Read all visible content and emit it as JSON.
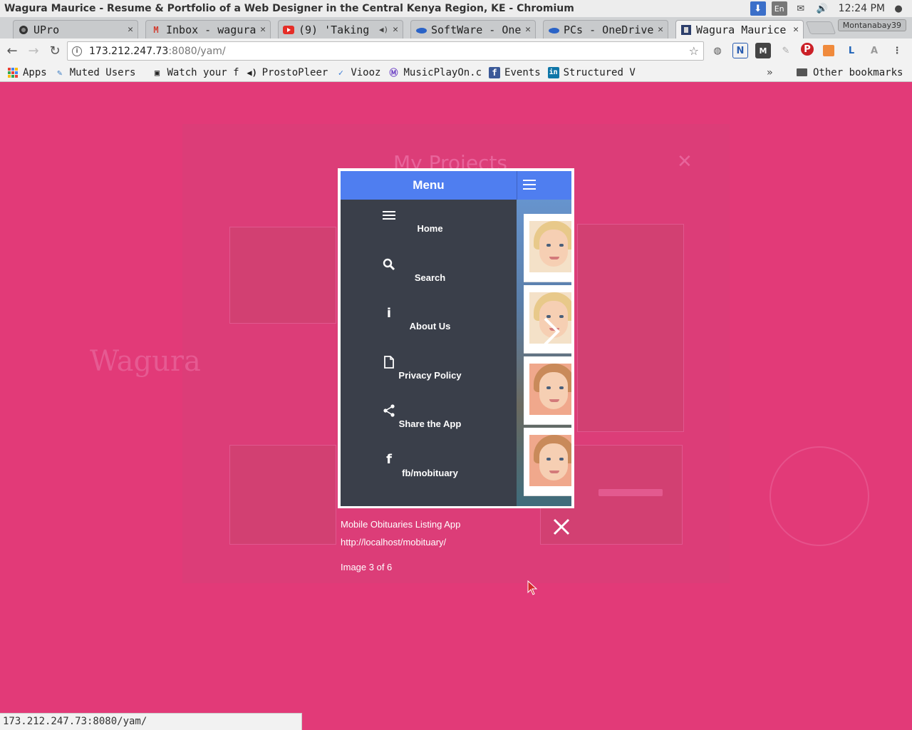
{
  "window": {
    "title": "Wagura Maurice - Resume & Portfolio of a Web Designer in the Central Kenya Region, KE - Chromium",
    "clock": "12:24 PM",
    "lang": "En"
  },
  "tabs": [
    {
      "label": "UPro",
      "icon": "upro-icon",
      "active": false
    },
    {
      "label": "Inbox - wagura",
      "icon": "gmail-icon",
      "active": false
    },
    {
      "label": "(9) 'Taking",
      "icon": "youtube-icon",
      "active": false,
      "audio": true
    },
    {
      "label": "SoftWare - One",
      "icon": "onedrive-icon",
      "active": false
    },
    {
      "label": "PCs - OneDrive",
      "icon": "onedrive-icon",
      "active": false
    },
    {
      "label": "Wagura Maurice",
      "icon": "site-icon",
      "active": true
    }
  ],
  "profile_name": "Montanabay39",
  "address": {
    "host": "173.212.247.73",
    "rest": ":8080/yam/"
  },
  "bookmarks": [
    {
      "label": "Apps",
      "icon": "apps-grid-icon"
    },
    {
      "label": "Muted Users",
      "icon": "tweetdeck-icon"
    },
    {
      "label": "Watch your f",
      "icon": "film-icon"
    },
    {
      "label": "ProstoPleer",
      "icon": "speaker-icon"
    },
    {
      "label": "Viooz",
      "icon": "viooz-icon"
    },
    {
      "label": "MusicPlayOn.c",
      "icon": "musicplayon-icon"
    },
    {
      "label": "Events",
      "icon": "facebook-icon"
    },
    {
      "label": "Structured V",
      "icon": "linkedin-icon"
    }
  ],
  "bookmarks_other": "Other bookmarks",
  "bookmarks_overflow": "»",
  "background": {
    "section_title": "My Projects",
    "name_heading": "Wagura"
  },
  "app": {
    "header": "Menu",
    "menu": [
      {
        "label": "Home",
        "icon": "hamburger-icon",
        "glyph": "≡"
      },
      {
        "label": "Search",
        "icon": "search-icon",
        "glyph": ""
      },
      {
        "label": "About Us",
        "icon": "info-icon",
        "glyph": "i"
      },
      {
        "label": "Privacy Policy",
        "icon": "document-icon",
        "glyph": ""
      },
      {
        "label": "Share the App",
        "icon": "share-icon",
        "glyph": ""
      },
      {
        "label": "fb/mobituary",
        "icon": "facebook-icon",
        "glyph": "f"
      }
    ]
  },
  "lightbox": {
    "caption": "Mobile Obituaries Listing App",
    "url": "http://localhost/mobituary/",
    "counter": "Image 3 of 6"
  },
  "status_url": "173.212.247.73:8080/yam/",
  "colors": {
    "page_bg": "#e23a78",
    "app_header": "#4f7ef0",
    "drawer_bg": "#3a3f4a"
  }
}
